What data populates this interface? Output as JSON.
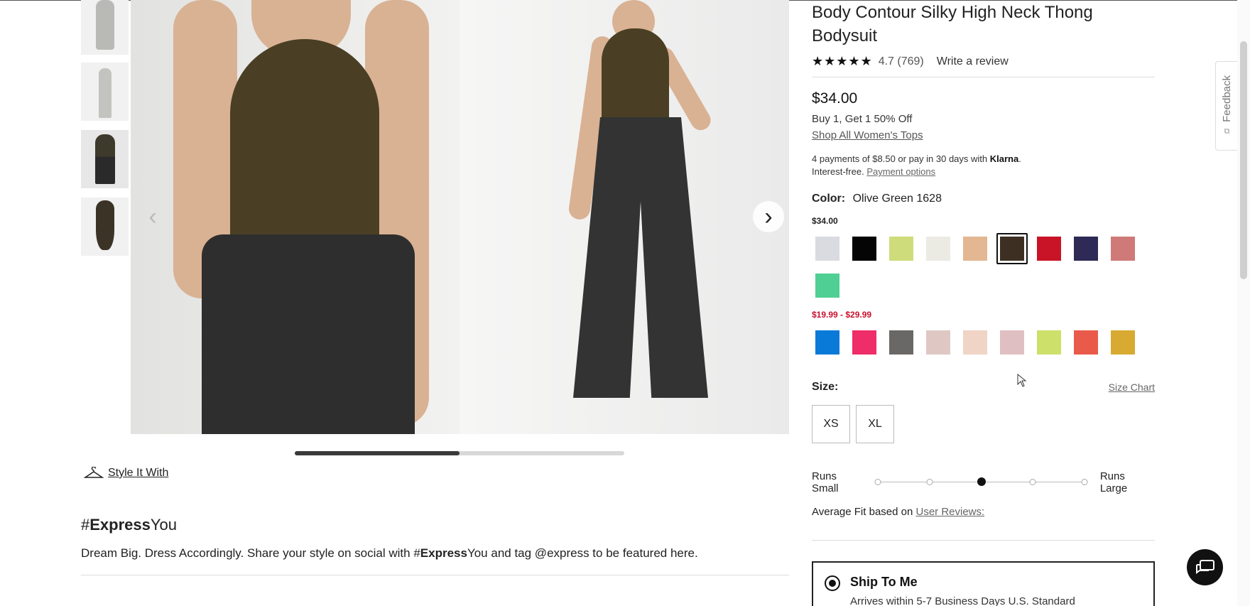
{
  "thumbnails": [
    {
      "label": "thumbnail-1"
    },
    {
      "label": "thumbnail-2"
    },
    {
      "label": "thumbnail-3"
    },
    {
      "label": "thumbnail-4"
    }
  ],
  "carousel": {
    "progress_fraction": 0.5,
    "prev_icon": "chevron-left-icon",
    "next_icon": "chevron-right-icon"
  },
  "style_it_with": "Style It With",
  "hashtag": {
    "prefix": "#",
    "bold": "Express",
    "suffix": "You"
  },
  "tagline": {
    "before": "Dream Big. Dress Accordingly. Share your style on social with #",
    "bold": "Express",
    "after": "You and tag @express to be featured here."
  },
  "product": {
    "title": "Body Contour Silky High Neck Thong Bodysuit",
    "stars": "★★★★★",
    "rating": "4.7",
    "review_count": "(769)",
    "write_review": "Write a review",
    "price": "$34.00",
    "promo": "Buy 1, Get 1 50% Off",
    "shop_link": "Shop All Women's Tops",
    "klarna_line1_prefix": "4 payments of $8.50 or pay in 30 days with ",
    "klarna_brand": "Klarna",
    "klarna_line1_suffix": ".",
    "klarna_line2_prefix": "Interest-free. ",
    "payment_options": "Payment options",
    "color_label": "Color:",
    "color_value": "Olive Green 1628",
    "regular_price_tag": "$34.00",
    "sale_price_tag": "$19.99 - $29.99",
    "regular_swatches": [
      "#d9dbe0",
      "#050505",
      "#cfdc7b",
      "#ebebe4",
      "#e2b792",
      "#3d3023",
      "#c81426",
      "#2d2a55",
      "#cf7a78",
      "#4fcf93"
    ],
    "selected_swatch_index": 5,
    "sale_swatches": [
      "#0a7ad8",
      "#ef2d68",
      "#6a6866",
      "#dfc8c4",
      "#f0d4c5",
      "#e0bfc2",
      "#cde06a",
      "#ea5a4a",
      "#d8aa32"
    ],
    "size_label": "Size:",
    "size_chart": "Size Chart",
    "sizes": [
      "XS",
      "XL"
    ],
    "fit_small": "Runs Small",
    "fit_large": "Runs Large",
    "fit_positions": 5,
    "fit_selected_index": 2,
    "avg_fit_prefix": "Average Fit based on ",
    "avg_fit_link": "User Reviews:",
    "ship_title": "Ship To Me",
    "ship_sub": "Arrives within 5-7 Business Days U.S. Standard"
  },
  "feedback": {
    "label": "Feedback",
    "icon": "feedback-icon"
  },
  "chat": {
    "icon": "chat-icon"
  }
}
